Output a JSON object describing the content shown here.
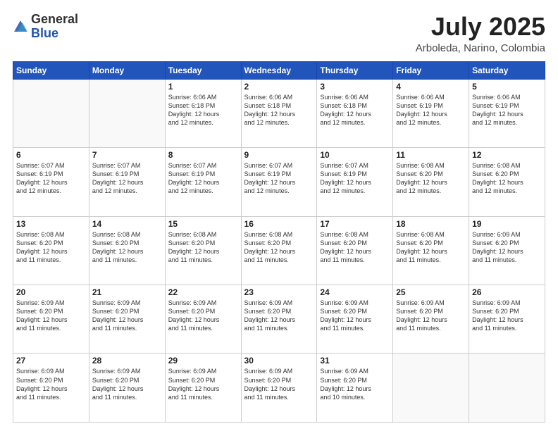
{
  "header": {
    "logo_general": "General",
    "logo_blue": "Blue",
    "month_year": "July 2025",
    "location": "Arboleda, Narino, Colombia"
  },
  "calendar": {
    "days_of_week": [
      "Sunday",
      "Monday",
      "Tuesday",
      "Wednesday",
      "Thursday",
      "Friday",
      "Saturday"
    ],
    "weeks": [
      [
        {
          "day": "",
          "info": ""
        },
        {
          "day": "",
          "info": ""
        },
        {
          "day": "1",
          "info": "Sunrise: 6:06 AM\nSunset: 6:18 PM\nDaylight: 12 hours\nand 12 minutes."
        },
        {
          "day": "2",
          "info": "Sunrise: 6:06 AM\nSunset: 6:18 PM\nDaylight: 12 hours\nand 12 minutes."
        },
        {
          "day": "3",
          "info": "Sunrise: 6:06 AM\nSunset: 6:18 PM\nDaylight: 12 hours\nand 12 minutes."
        },
        {
          "day": "4",
          "info": "Sunrise: 6:06 AM\nSunset: 6:19 PM\nDaylight: 12 hours\nand 12 minutes."
        },
        {
          "day": "5",
          "info": "Sunrise: 6:06 AM\nSunset: 6:19 PM\nDaylight: 12 hours\nand 12 minutes."
        }
      ],
      [
        {
          "day": "6",
          "info": "Sunrise: 6:07 AM\nSunset: 6:19 PM\nDaylight: 12 hours\nand 12 minutes."
        },
        {
          "day": "7",
          "info": "Sunrise: 6:07 AM\nSunset: 6:19 PM\nDaylight: 12 hours\nand 12 minutes."
        },
        {
          "day": "8",
          "info": "Sunrise: 6:07 AM\nSunset: 6:19 PM\nDaylight: 12 hours\nand 12 minutes."
        },
        {
          "day": "9",
          "info": "Sunrise: 6:07 AM\nSunset: 6:19 PM\nDaylight: 12 hours\nand 12 minutes."
        },
        {
          "day": "10",
          "info": "Sunrise: 6:07 AM\nSunset: 6:19 PM\nDaylight: 12 hours\nand 12 minutes."
        },
        {
          "day": "11",
          "info": "Sunrise: 6:08 AM\nSunset: 6:20 PM\nDaylight: 12 hours\nand 12 minutes."
        },
        {
          "day": "12",
          "info": "Sunrise: 6:08 AM\nSunset: 6:20 PM\nDaylight: 12 hours\nand 12 minutes."
        }
      ],
      [
        {
          "day": "13",
          "info": "Sunrise: 6:08 AM\nSunset: 6:20 PM\nDaylight: 12 hours\nand 11 minutes."
        },
        {
          "day": "14",
          "info": "Sunrise: 6:08 AM\nSunset: 6:20 PM\nDaylight: 12 hours\nand 11 minutes."
        },
        {
          "day": "15",
          "info": "Sunrise: 6:08 AM\nSunset: 6:20 PM\nDaylight: 12 hours\nand 11 minutes."
        },
        {
          "day": "16",
          "info": "Sunrise: 6:08 AM\nSunset: 6:20 PM\nDaylight: 12 hours\nand 11 minutes."
        },
        {
          "day": "17",
          "info": "Sunrise: 6:08 AM\nSunset: 6:20 PM\nDaylight: 12 hours\nand 11 minutes."
        },
        {
          "day": "18",
          "info": "Sunrise: 6:08 AM\nSunset: 6:20 PM\nDaylight: 12 hours\nand 11 minutes."
        },
        {
          "day": "19",
          "info": "Sunrise: 6:09 AM\nSunset: 6:20 PM\nDaylight: 12 hours\nand 11 minutes."
        }
      ],
      [
        {
          "day": "20",
          "info": "Sunrise: 6:09 AM\nSunset: 6:20 PM\nDaylight: 12 hours\nand 11 minutes."
        },
        {
          "day": "21",
          "info": "Sunrise: 6:09 AM\nSunset: 6:20 PM\nDaylight: 12 hours\nand 11 minutes."
        },
        {
          "day": "22",
          "info": "Sunrise: 6:09 AM\nSunset: 6:20 PM\nDaylight: 12 hours\nand 11 minutes."
        },
        {
          "day": "23",
          "info": "Sunrise: 6:09 AM\nSunset: 6:20 PM\nDaylight: 12 hours\nand 11 minutes."
        },
        {
          "day": "24",
          "info": "Sunrise: 6:09 AM\nSunset: 6:20 PM\nDaylight: 12 hours\nand 11 minutes."
        },
        {
          "day": "25",
          "info": "Sunrise: 6:09 AM\nSunset: 6:20 PM\nDaylight: 12 hours\nand 11 minutes."
        },
        {
          "day": "26",
          "info": "Sunrise: 6:09 AM\nSunset: 6:20 PM\nDaylight: 12 hours\nand 11 minutes."
        }
      ],
      [
        {
          "day": "27",
          "info": "Sunrise: 6:09 AM\nSunset: 6:20 PM\nDaylight: 12 hours\nand 11 minutes."
        },
        {
          "day": "28",
          "info": "Sunrise: 6:09 AM\nSunset: 6:20 PM\nDaylight: 12 hours\nand 11 minutes."
        },
        {
          "day": "29",
          "info": "Sunrise: 6:09 AM\nSunset: 6:20 PM\nDaylight: 12 hours\nand 11 minutes."
        },
        {
          "day": "30",
          "info": "Sunrise: 6:09 AM\nSunset: 6:20 PM\nDaylight: 12 hours\nand 11 minutes."
        },
        {
          "day": "31",
          "info": "Sunrise: 6:09 AM\nSunset: 6:20 PM\nDaylight: 12 hours\nand 10 minutes."
        },
        {
          "day": "",
          "info": ""
        },
        {
          "day": "",
          "info": ""
        }
      ]
    ]
  }
}
